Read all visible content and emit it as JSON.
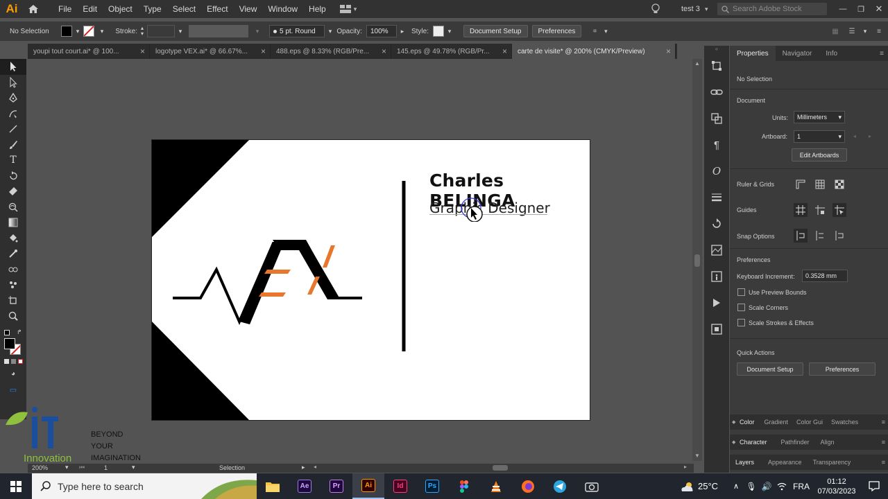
{
  "app": {
    "logo": "Ai",
    "menus": [
      "File",
      "Edit",
      "Object",
      "Type",
      "Select",
      "Effect",
      "View",
      "Window",
      "Help"
    ],
    "workspace": "test 3",
    "search_placeholder": "Search Adobe Stock"
  },
  "control_bar": {
    "selection": "No Selection",
    "stroke_label": "Stroke:",
    "brush": "5 pt. Round",
    "opacity_label": "Opacity:",
    "opacity_value": "100%",
    "style_label": "Style:",
    "document_setup": "Document Setup",
    "preferences": "Preferences"
  },
  "tabs": [
    {
      "label": "youpi tout court.ai* @ 100...",
      "active": false
    },
    {
      "label": "logotype VEX.ai* @ 66.67%...",
      "active": false
    },
    {
      "label": "488.eps @ 8.33% (RGB/Pre...",
      "active": false
    },
    {
      "label": "145.eps @ 49.78% (RGB/Pr...",
      "active": false
    },
    {
      "label": "carte de visite* @ 200% (CMYK/Preview)",
      "active": true
    }
  ],
  "artboard": {
    "name": "Charles BELINGA",
    "title": "Graphic Designer"
  },
  "panel": {
    "tabs": [
      "Properties",
      "Navigator",
      "Info"
    ],
    "no_selection": "No Selection",
    "document": "Document",
    "units_label": "Units:",
    "units_value": "Millimeters",
    "artboard_label": "Artboard:",
    "artboard_value": "1",
    "edit_artboards": "Edit Artboards",
    "ruler_grids": "Ruler & Grids",
    "guides": "Guides",
    "snap_options": "Snap Options",
    "preferences": "Preferences",
    "keyboard_increment_label": "Keyboard Increment:",
    "keyboard_increment_value": "0.3528 mm",
    "use_preview_bounds": "Use Preview Bounds",
    "scale_corners": "Scale Corners",
    "scale_strokes": "Scale Strokes & Effects",
    "quick_actions": "Quick Actions",
    "qa_document_setup": "Document Setup",
    "qa_preferences": "Preferences",
    "collapsed1": [
      "Color",
      "Gradient",
      "Color Gui",
      "Swatches"
    ],
    "collapsed2": [
      "Character",
      "Pathfinder",
      "Align"
    ],
    "collapsed3": [
      "Layers",
      "Appearance",
      "Transparency"
    ]
  },
  "status": {
    "zoom": "200%",
    "artboard": "1",
    "tool": "Selection"
  },
  "watermark": {
    "line1": "BEYOND",
    "line2": "YOUR",
    "line3": "IMAGINATION",
    "brand": "Innovation"
  },
  "taskbar": {
    "search_placeholder": "Type here to search",
    "temperature": "25°C",
    "language": "FRA",
    "time": "01:12",
    "date": "07/03/2023",
    "apps": [
      "Ae",
      "Pr",
      "Ai",
      "Id",
      "Ps"
    ]
  },
  "colors": {
    "accent_orange": "#e8772e",
    "illustrator_orange": "#ff9a00"
  }
}
